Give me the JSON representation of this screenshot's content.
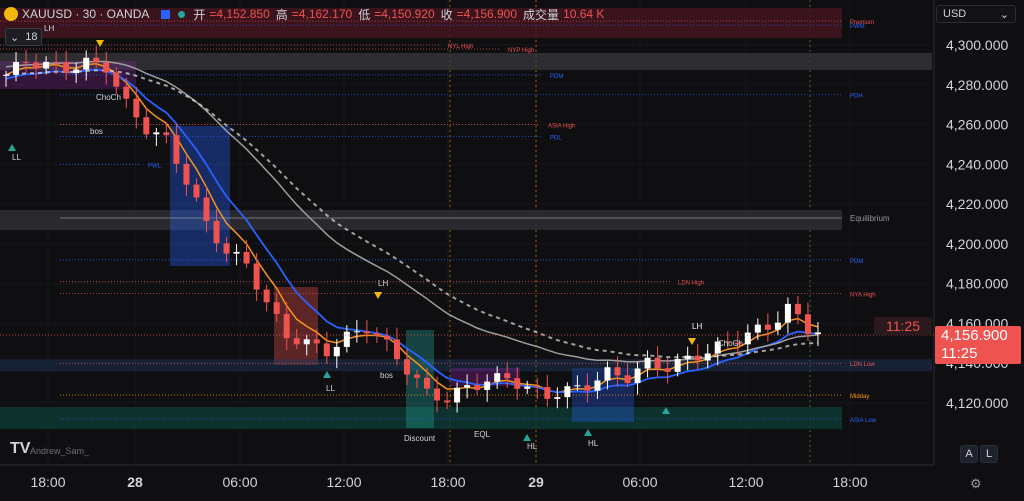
{
  "header": {
    "symbol": "XAUUSD · 30 · OANDA",
    "open_label": "开",
    "open": "=4,152.850",
    "high_label": "高",
    "high": "=4,162.170",
    "low_label": "低",
    "low": "=4,150.920",
    "close_label": "收",
    "close": "=4,156.900",
    "volume_label": "成交量",
    "volume": "10.64 K",
    "indicators_collapse": "18"
  },
  "currency_selector": "USD",
  "price_axis": {
    "labels": [
      "4,300.000",
      "4,280.000",
      "4,260.000",
      "4,240.000",
      "4,220.000",
      "4,200.000",
      "4,180.000",
      "4,160.000",
      "4,140.000",
      "4,120.000"
    ],
    "values": [
      4300,
      4280,
      4260,
      4240,
      4220,
      4200,
      4180,
      4160,
      4140,
      4120
    ],
    "last_price": "4,156.900",
    "countdown": "11:25"
  },
  "time_axis": {
    "labels": [
      "18:00",
      "28",
      "06:00",
      "12:00",
      "18:00",
      "29",
      "06:00",
      "12:00",
      "18:00"
    ]
  },
  "buttons": {
    "auto": "A",
    "log": "L"
  },
  "watermark": {
    "logo": "TV",
    "author": "Andrew_Sam_"
  },
  "colors": {
    "bull": "#ffffff",
    "bear": "#ef5350",
    "ema_fast": "#f7931a",
    "ema_slow": "#2962ff",
    "ema_long": "#9e9e9e",
    "premium_zone": "#4a1520",
    "equilibrium_zone": "#2a2a2e",
    "discount_zone": "#0c3a34"
  },
  "chart_data": {
    "type": "candlestick",
    "symbol": "XAUUSD",
    "timeframe": "30",
    "ylim": [
      4108,
      4315
    ],
    "x": [
      "27 18:00",
      "28 00:00",
      "28 06:00",
      "28 12:00",
      "28 18:00",
      "29 00:00",
      "29 06:00",
      "29 12:00",
      "29 18:00"
    ],
    "close_path": [
      4285,
      4292,
      4290,
      4288,
      4291,
      4289,
      4270,
      4258,
      4252,
      4232,
      4210,
      4196,
      4190,
      4170,
      4154,
      4150,
      4146,
      4153,
      4158,
      4149,
      4137,
      4125,
      4122,
      4128,
      4131,
      4133,
      4127,
      4124,
      4126,
      4129,
      4135,
      4133,
      4140,
      4138,
      4142,
      4146,
      4150,
      4155,
      4158,
      4168,
      4157
    ],
    "levels": [
      {
        "label": "Premium",
        "value": 4312
      },
      {
        "label": "NYL High",
        "value": 4300
      },
      {
        "label": "NYP High",
        "value": 4298
      },
      {
        "label": "PWM",
        "value": 4310
      },
      {
        "label": "PDM",
        "value": 4285
      },
      {
        "label": "PDH",
        "value": 4275
      },
      {
        "label": "ASIA High",
        "value": 4260
      },
      {
        "label": "PDL",
        "value": 4254
      },
      {
        "label": "PWL",
        "value": 4240
      },
      {
        "label": "Equilibrium",
        "value": 4213
      },
      {
        "label": "PDM",
        "value": 4192
      },
      {
        "label": "LDN High",
        "value": 4181
      },
      {
        "label": "NYA High",
        "value": 4175
      },
      {
        "label": "LDN Low",
        "value": 4140
      },
      {
        "label": "Midday",
        "value": 4124
      },
      {
        "label": "ASIA Low",
        "value": 4112
      }
    ],
    "structure_labels": [
      "LH",
      "LL",
      "bos",
      "ChoCh",
      "LH",
      "LL",
      "LH",
      "HL",
      "HL",
      "LH",
      "ChoCh",
      "bos",
      "EQL",
      "Discount"
    ]
  }
}
